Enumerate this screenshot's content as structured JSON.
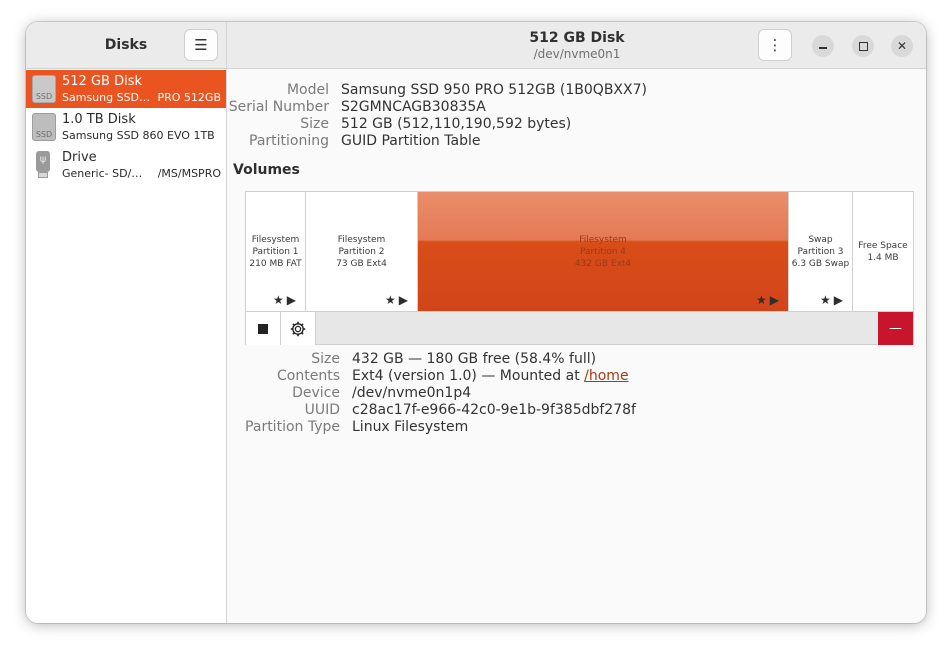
{
  "sidebar": {
    "title": "Disks",
    "disks": [
      {
        "name": "512 GB Disk",
        "sub": "Samsung SSD…",
        "sub_end": "PRO 512GB",
        "icon": "ssd-icon",
        "icon_label": "SSD"
      },
      {
        "name": "1.0 TB Disk",
        "sub": "Samsung SSD 860 EVO 1TB",
        "sub_end": "",
        "icon": "ssd-icon",
        "icon_label": "SSD"
      },
      {
        "name": "Drive",
        "sub": "Generic- SD/…",
        "sub_end": "/MS/MSPRO",
        "icon": "usb-drive-icon",
        "icon_label": ""
      }
    ]
  },
  "header": {
    "title": "512 GB Disk",
    "subtitle": "/dev/nvme0n1"
  },
  "disk_info": {
    "model_label": "Model",
    "model": "Samsung SSD 950 PRO 512GB (1B0QBXX7)",
    "serial_label": "Serial Number",
    "serial": "S2GMNCAGB30835A",
    "size_label": "Size",
    "size": "512 GB (512,110,190,592 bytes)",
    "partitioning_label": "Partitioning",
    "partitioning": "GUID Partition Table"
  },
  "volumes": {
    "title": "Volumes",
    "partitions": [
      {
        "line1": "Filesystem",
        "line2": "Partition 1",
        "line3": "210 MB FAT",
        "selected": false
      },
      {
        "line1": "Filesystem",
        "line2": "Partition 2",
        "line3": "73 GB Ext4",
        "selected": false
      },
      {
        "line1": "Filesystem",
        "line2": "Partition 4",
        "line3": "432 GB Ext4",
        "selected": true
      },
      {
        "line1": "Swap",
        "line2": "Partition 3",
        "line3": "6.3 GB Swap",
        "selected": false
      },
      {
        "line1": "Free Space",
        "line2": "1.4 MB",
        "line3": "",
        "selected": false
      }
    ]
  },
  "partition_details": {
    "size_label": "Size",
    "size": "432 GB — 180 GB free (58.4% full)",
    "contents_label": "Contents",
    "contents_prefix": "Ext4 (version 1.0) — Mounted at",
    "mount_point": "/home",
    "device_label": "Device",
    "device": "/dev/nvme0n1p4",
    "uuid_label": "UUID",
    "uuid": "c28ac17f-e966-42c0-9e1b-9f385dbf278f",
    "type_label": "Partition Type",
    "type": "Linux Filesystem"
  },
  "colors": {
    "accent": "#e95420",
    "destructive": "#c7162b"
  }
}
